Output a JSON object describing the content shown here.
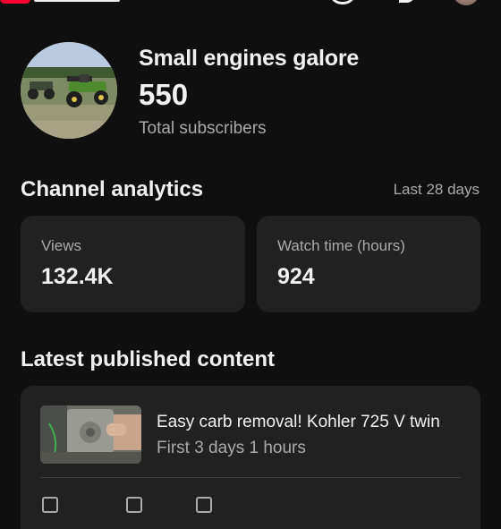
{
  "channel": {
    "name": "Small engines galore",
    "subscriber_count": "550",
    "subscriber_label": "Total subscribers"
  },
  "analytics": {
    "title": "Channel analytics",
    "range": "Last 28 days",
    "cards": [
      {
        "label": "Views",
        "value": "132.4K"
      },
      {
        "label": "Watch time (hours)",
        "value": "924"
      }
    ]
  },
  "latest": {
    "title": "Latest published content",
    "video": {
      "title": "Easy carb removal! Kohler 725 V twin",
      "meta": "First 3 days 1 hours"
    }
  },
  "colors": {
    "background": "#0f0f0f",
    "card": "#212121",
    "text_primary": "#f1f1f1",
    "text_secondary": "#aaaaaa",
    "brand": "#ff0033"
  },
  "icons": [
    "youtube-logo",
    "search-icon",
    "notifications-icon",
    "account-avatar"
  ]
}
